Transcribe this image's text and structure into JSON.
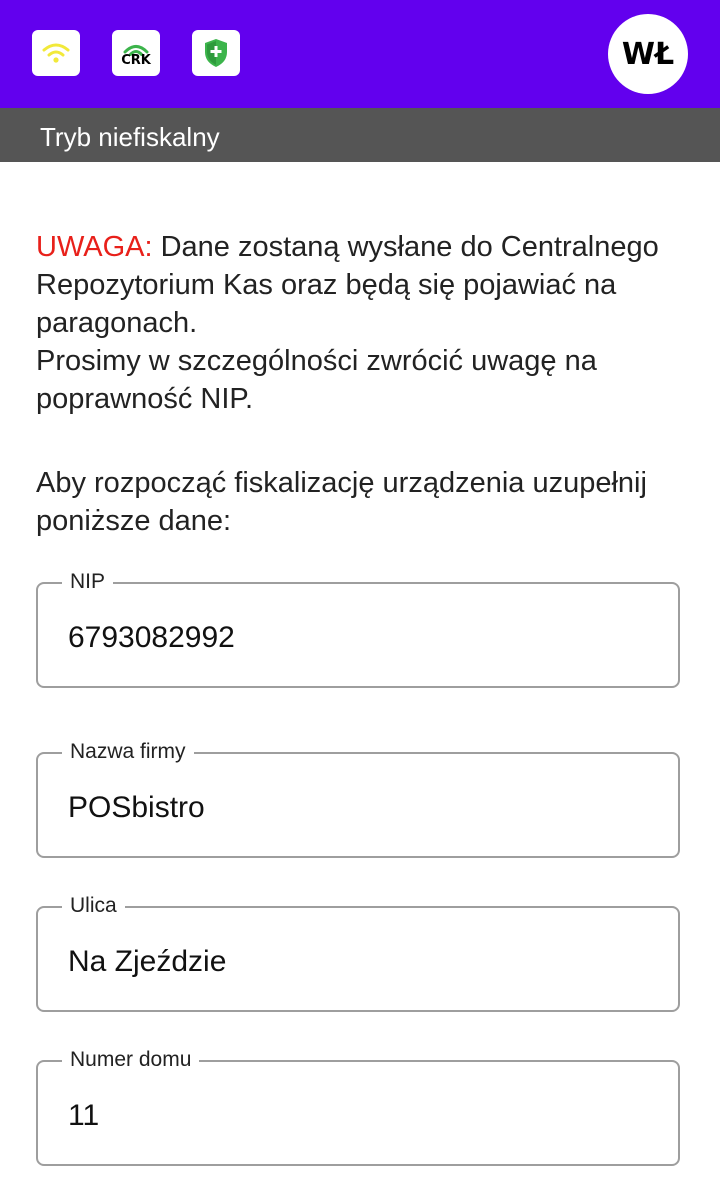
{
  "header": {
    "status_icons": [
      {
        "name": "wifi-icon",
        "color": "#f2e93a"
      },
      {
        "name": "crk-icon",
        "label": "CRK",
        "color": "#3cb44b"
      },
      {
        "name": "shield-check-icon",
        "color": "#3cb44b"
      }
    ],
    "avatar_initials": "WŁ",
    "background_color": "#6200ee"
  },
  "mode_bar": {
    "text": "Tryb niefiskalny",
    "background_color": "#555555"
  },
  "warning": {
    "label": "UWAGA:",
    "label_color": "#e8201a",
    "text": " Dane zostaną wysłane do Centralnego Repozytorium Kas oraz będą się pojawiać na paragonach.\nProsimy w szczególności zwrócić uwagę na poprawność NIP."
  },
  "instruction": "Aby rozpocząć fiskalizację urządzenia uzupełnij poniższe dane:",
  "form": {
    "fields": [
      {
        "label": "NIP",
        "value": "6793082992"
      },
      {
        "label": "Nazwa firmy",
        "value": "POSbistro"
      },
      {
        "label": "Ulica",
        "value": "Na Zjeździe"
      },
      {
        "label": "Numer domu",
        "value": "11"
      }
    ]
  }
}
